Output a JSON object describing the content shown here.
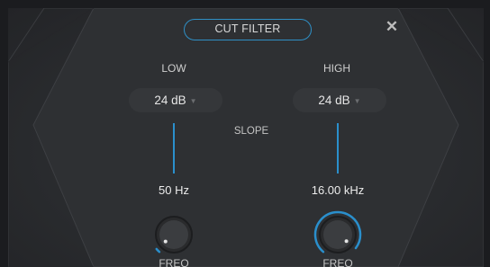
{
  "header": {
    "title": "CUT FILTER",
    "close_icon": "close-icon"
  },
  "low": {
    "label": "LOW",
    "slope": "24 dB",
    "frequency": "50 Hz",
    "knob_label": "FREQ",
    "knob_value_fraction": 0.02
  },
  "high": {
    "label": "HIGH",
    "slope": "24 dB",
    "frequency": "16.00 kHz",
    "knob_label": "FREQ",
    "knob_value_fraction": 0.97
  },
  "slope_label": "SLOPE",
  "colors": {
    "accent": "#2a8fcc",
    "background": "#2b2d30",
    "text": "#e6e6e6"
  },
  "icons": {
    "dropdown": "caret-down-icon",
    "close": "close-icon"
  }
}
